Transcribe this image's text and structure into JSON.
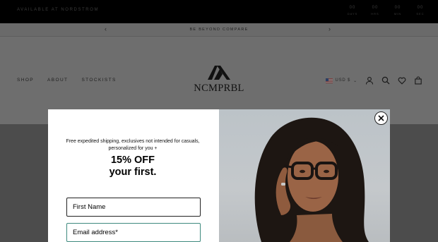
{
  "topbar": {
    "promo": "AVAILABLE AT NORDSTROM",
    "countdown": [
      {
        "value": "00",
        "label": "DAYS"
      },
      {
        "value": "00",
        "label": "HRS"
      },
      {
        "value": "00",
        "label": "MIN"
      },
      {
        "value": "00",
        "label": "SEC"
      }
    ]
  },
  "announcement": {
    "message": "BE BEYOND COMPARE",
    "prev_icon": "chevron-left-icon",
    "next_icon": "chevron-right-icon"
  },
  "header": {
    "nav": [
      "SHOP",
      "ABOUT",
      "STOCKISTS"
    ],
    "logo_text": "NCMPRBL",
    "locale": "USD $",
    "icons": [
      "account-icon",
      "search-icon",
      "heart-icon",
      "bag-icon"
    ]
  },
  "popup": {
    "lead": "Free expedited shipping, exclusives not intended for casuals, personalized for you +",
    "headline_line1": "15% OFF",
    "headline_line2": "your first.",
    "first_name_placeholder": "First Name",
    "email_placeholder": "Email address*",
    "close_icon": "close-icon"
  },
  "colors": {
    "overlay": "#6e6e6e",
    "topbar": "#000000",
    "email_focus": "#3e8a7e"
  }
}
